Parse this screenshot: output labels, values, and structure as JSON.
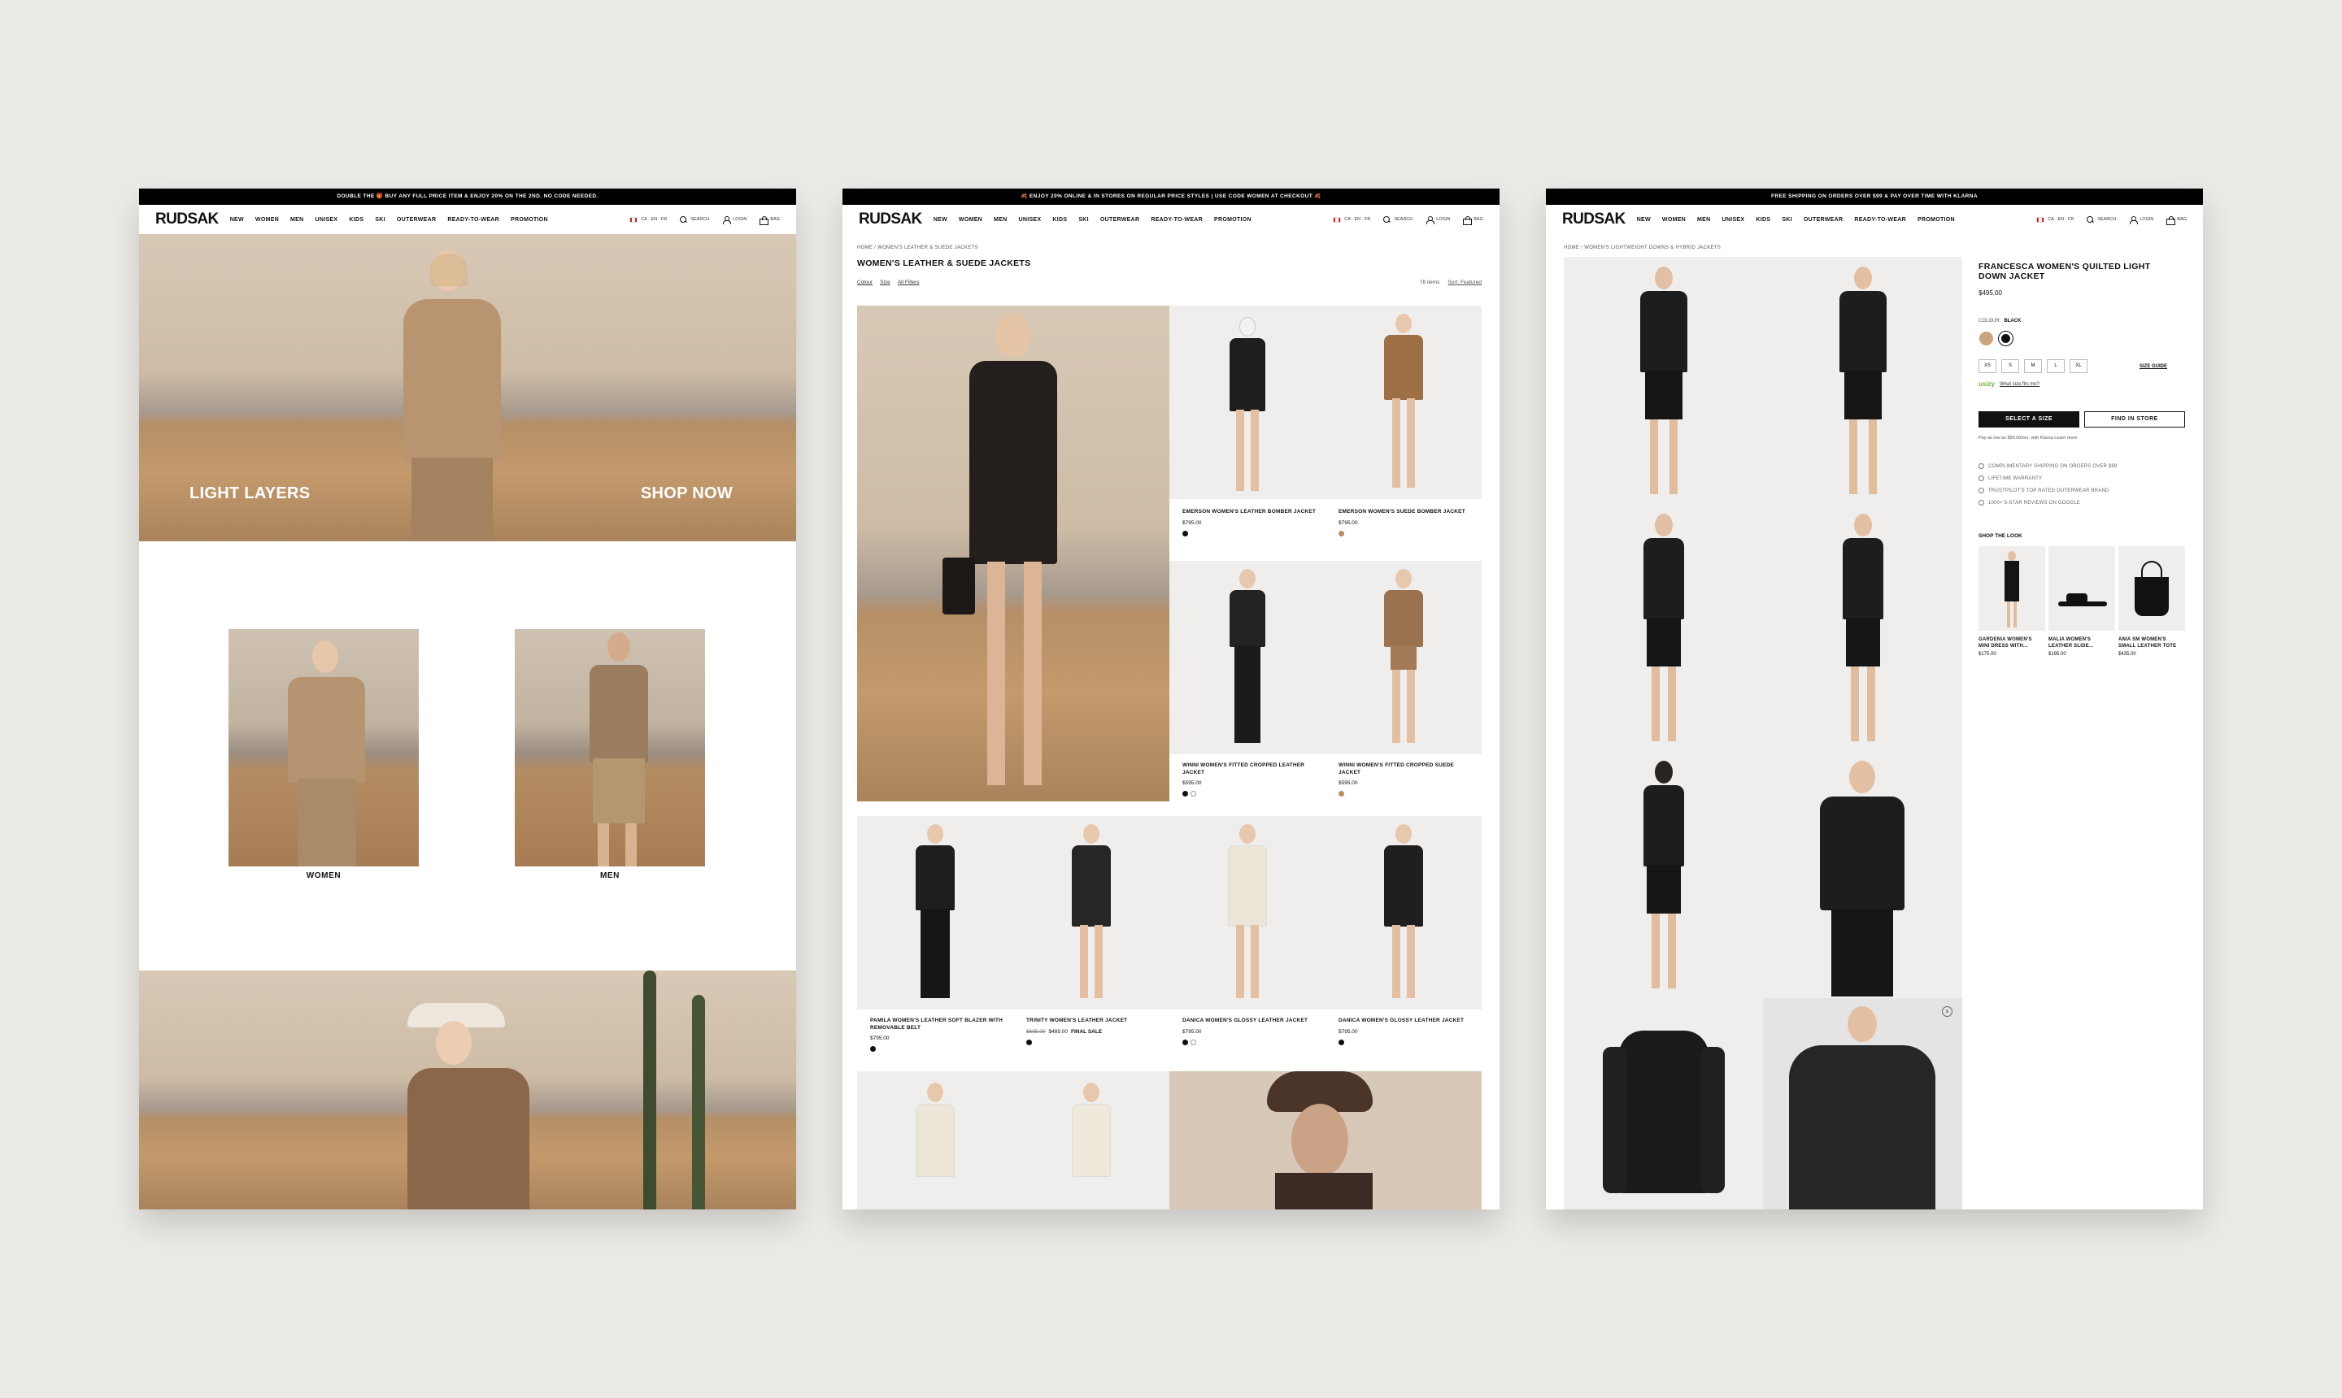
{
  "brand": "RUDSAK",
  "nav_items": [
    "NEW",
    "WOMEN",
    "MEN",
    "UNISEX",
    "KIDS",
    "SKI",
    "OUTERWEAR",
    "READY-TO-WEAR",
    "PROMOTION"
  ],
  "util": {
    "region": "CA · EN · FR",
    "search": "SEARCH",
    "login": "LOGIN",
    "bag": "BAG"
  },
  "home": {
    "promo": "DOUBLE THE 🎁 BUY ANY FULL PRICE ITEM & ENJOY 20% ON THE 2ND. NO CODE NEEDED.",
    "hero_left": "LIGHT LAYERS",
    "hero_right": "SHOP NOW",
    "women_label": "WOMEN",
    "men_label": "MEN"
  },
  "plp": {
    "promo": "🍂 ENJOY 20% ONLINE & IN STORES ON REGULAR PRICE STYLES | USE CODE WOMEN AT CHECKOUT 🍂",
    "breadcrumb": "HOME  /  WOMEN'S LEATHER & SUEDE JACKETS",
    "title": "WOMEN'S LEATHER & SUEDE JACKETS",
    "filters": [
      "Colour",
      "Size",
      "All Filters"
    ],
    "count": "78 items",
    "sort": "Sort: Featured",
    "products": [
      {
        "name": "EMERSON WOMEN'S LEATHER BOMBER JACKET",
        "price": "$795.00"
      },
      {
        "name": "EMERSON WOMEN'S SUEDE BOMBER JACKET",
        "price": "$795.00"
      },
      {
        "name": "WINNI WOMEN'S FITTED CROPPED LEATHER JACKET",
        "price": "$595.00"
      },
      {
        "name": "WINNI WOMEN'S FITTED CROPPED SUEDE JACKET",
        "price": "$595.00"
      },
      {
        "name": "PAMILA WOMEN'S LEATHER SOFT BLAZER WITH REMOVABLE BELT",
        "price": "$795.00"
      },
      {
        "name": "TRINITY WOMEN'S LEATHER JACKET",
        "price_old": "$695.00",
        "price": "$489.00",
        "badge": "FINAL SALE"
      },
      {
        "name": "DANICA WOMEN'S GLOSSY LEATHER JACKET",
        "price": "$795.00"
      },
      {
        "name": "DANICA WOMEN'S GLOSSY LEATHER JACKET",
        "price": "$795.00"
      }
    ]
  },
  "pdp": {
    "promo": "FREE SHIPPING ON ORDERS OVER $99 & PAY OVER TIME WITH KLARNA",
    "breadcrumb": "HOME  /  WOMEN'S LIGHTWEIGHT DOWNS & HYBRID JACKETS",
    "title": "FRANCESCA WOMEN'S QUILTED LIGHT DOWN JACKET",
    "price": "$495.00",
    "colour_label": "COLOUR:",
    "colour_value": "BLACK",
    "sizes": [
      "XS",
      "S",
      "M",
      "L",
      "XL"
    ],
    "size_guide": "SIZE GUIDE",
    "usizy": "usizy",
    "usizy_link": "What size fits me?",
    "select_size": "SELECT A SIZE",
    "find_in_store": "FIND IN STORE",
    "klarna": "Pay as low as $99.00/mo. with Klarna Learn more",
    "benefits": [
      "COMPLIMENTARY SHIPPING ON ORDERS OVER $99",
      "LIFETIME WARRANTY",
      "TRUSTPILOT'S TOP RATED OUTERWEAR BRAND",
      "1000+ 5-STAR REVIEWS ON GOOGLE"
    ],
    "shop_the_look": "SHOP THE LOOK",
    "look": [
      {
        "name": "GARDENIA WOMEN'S MINI DRESS WITH...",
        "price": "$175.00"
      },
      {
        "name": "MALIA WOMEN'S LEATHER SLIDE...",
        "price": "$195.00"
      },
      {
        "name": "ANIA SM WOMEN'S SMALL LEATHER TOTE",
        "price": "$435.00"
      }
    ]
  },
  "colors": {
    "accent": "#111111",
    "tan": "#C9A47E",
    "usizy": "#6CB33F"
  }
}
